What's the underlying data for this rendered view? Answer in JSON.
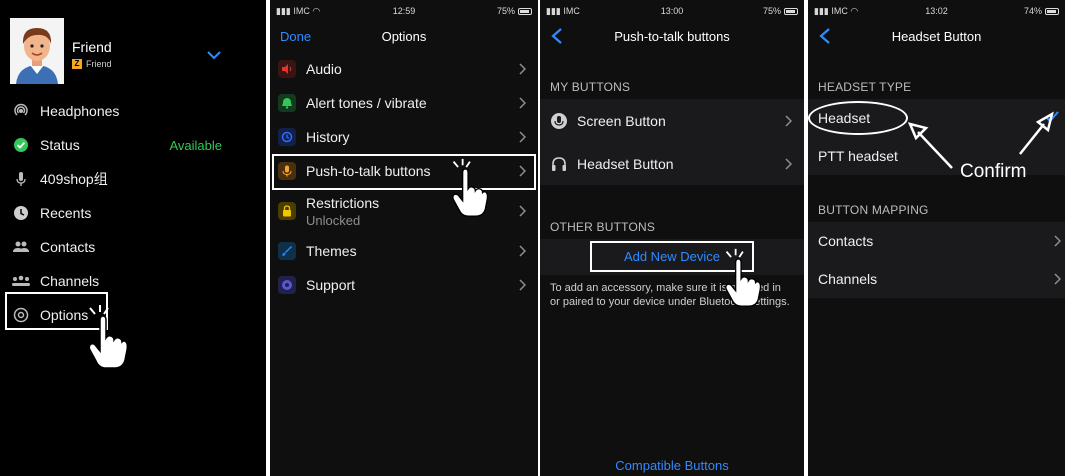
{
  "panel1": {
    "profile": {
      "name": "Friend",
      "subtitle": "Friend",
      "badge": "Z"
    },
    "menu": [
      {
        "label": "Headphones",
        "icon": "headphones-radio-icon",
        "right": ""
      },
      {
        "label": "Status",
        "icon": "check-circle-icon",
        "right": "Available"
      },
      {
        "label": "409shop组",
        "icon": "microphone-icon",
        "right": ""
      },
      {
        "label": "Recents",
        "icon": "clock-icon",
        "right": ""
      },
      {
        "label": "Contacts",
        "icon": "contacts-icon",
        "right": ""
      },
      {
        "label": "Channels",
        "icon": "channels-icon",
        "right": ""
      },
      {
        "label": "Options",
        "icon": "gear-icon",
        "right": ""
      }
    ],
    "colors": {
      "available": "#34c759"
    }
  },
  "panel2": {
    "status": {
      "carrier": "IMC",
      "time": "12:59",
      "battery": "75%"
    },
    "nav": {
      "left": "Done",
      "title": "Options"
    },
    "items": [
      {
        "label": "Audio",
        "sub": "",
        "icon": "speaker-icon",
        "color": "#e0342c"
      },
      {
        "label": "Alert tones / vibrate",
        "sub": "",
        "icon": "bell-icon",
        "color": "#34c759"
      },
      {
        "label": "History",
        "sub": "",
        "icon": "history-icon",
        "color": "#2f6bff"
      },
      {
        "label": "Push-to-talk buttons",
        "sub": "",
        "icon": "microphone-icon",
        "color": "#f5a623"
      },
      {
        "label": "Restrictions",
        "sub": "Unlocked",
        "icon": "lock-icon",
        "color": "#f5c400"
      },
      {
        "label": "Themes",
        "sub": "",
        "icon": "brush-icon",
        "color": "#1f8fff"
      },
      {
        "label": "Support",
        "sub": "",
        "icon": "support-icon",
        "color": "#5856d6"
      }
    ]
  },
  "panel3": {
    "status": {
      "carrier": "IMC",
      "time": "13:00",
      "battery": "75%"
    },
    "nav": {
      "title": "Push-to-talk buttons"
    },
    "my_buttons_header": "MY BUTTONS",
    "my_buttons": [
      {
        "label": "Screen Button",
        "icon": "screen-button-icon"
      },
      {
        "label": "Headset Button",
        "icon": "headset-icon"
      }
    ],
    "other_buttons_header": "OTHER BUTTONS",
    "add_device": "Add New Device",
    "footnote": "To add an accessory, make sure it is plugged in or paired to your device under Bluetooth settings.",
    "compatible": "Compatible Buttons"
  },
  "panel4": {
    "status": {
      "carrier": "IMC",
      "time": "13:02",
      "battery": "74%"
    },
    "nav": {
      "title": "Headset Button"
    },
    "headset_type_header": "HEADSET TYPE",
    "headset_types": [
      {
        "label": "Headset",
        "selected": true
      },
      {
        "label": "PTT headset",
        "selected": false
      }
    ],
    "mapping_header": "BUTTON MAPPING",
    "mapping": [
      {
        "label": "Contacts"
      },
      {
        "label": "Channels"
      }
    ],
    "annotation": "Confirm"
  }
}
